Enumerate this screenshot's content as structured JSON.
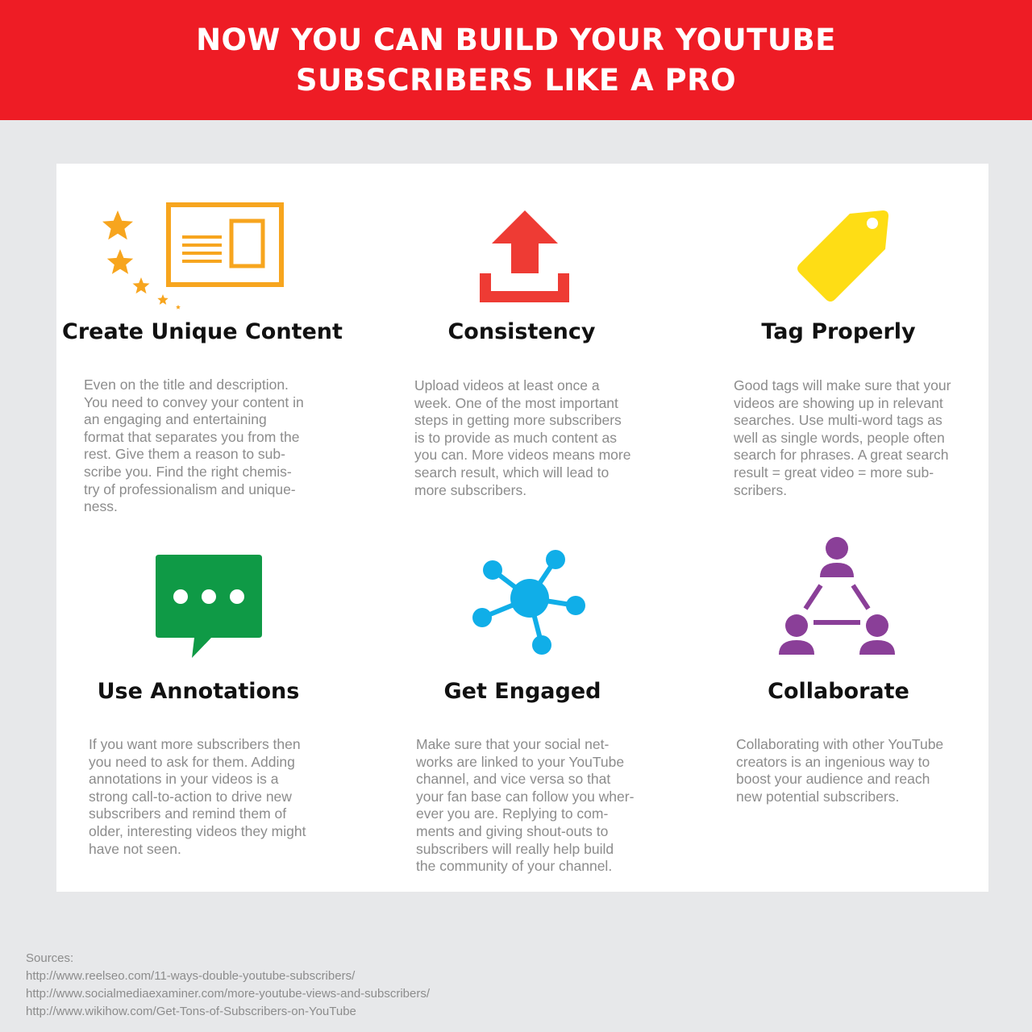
{
  "header": {
    "line1": "NOW YOU CAN BUILD YOUR YOUTUBE",
    "line2": "SUBSCRIBERS LIKE A PRO"
  },
  "colors": {
    "header_red": "#ee1c25",
    "content_orange": "#f7a51e",
    "upload_red": "#ee3b34",
    "tag_yellow": "#fedd15",
    "annotation_green": "#0f9a46",
    "engaged_blue": "#10aee8",
    "collab_purple": "#8a3f98"
  },
  "tips": [
    {
      "icon": "content-card-stars-icon",
      "title": "Create Unique Content",
      "text": "Even on the title and description.\nYou need to convey your content in\nan engaging and entertaining\nformat that separates you from the\nrest. Give them a reason to sub-\nscribe you. Find the right chemis-\ntry of professionalism and unique-\nness."
    },
    {
      "icon": "upload-icon",
      "title": "Consistency",
      "text": "Upload videos at least once a\nweek. One of the most important\nsteps in getting more subscribers\nis to provide as much content as\nyou can. More videos means more\nsearch result, which will lead to\nmore subscribers."
    },
    {
      "icon": "tag-icon",
      "title": "Tag Properly",
      "text": "Good tags will make sure that your\nvideos are showing up in relevant\nsearches. Use multi-word tags as\nwell as single words, people often\nsearch for phrases. A great search\nresult = great video = more sub-\nscribers."
    },
    {
      "icon": "speech-bubble-icon",
      "title": "Use Annotations",
      "text": "If you want more subscribers then\nyou need to ask for them. Adding\nannotations in your videos is a\nstrong call-to-action to drive new\nsubscribers and remind them of\nolder, interesting videos they might\nhave not seen."
    },
    {
      "icon": "network-icon",
      "title": "Get Engaged",
      "text": "Make sure that your social net-\nworks are linked to your YouTube\nchannel, and vice versa so that\nyour fan base can follow you wher-\never you are. Replying to com-\nments and giving shout-outs to\nsubscribers will really help build\nthe community of your channel."
    },
    {
      "icon": "people-triangle-icon",
      "title": "Collaborate",
      "text": "Collaborating with other YouTube\ncreators is an ingenious way to\nboost your audience and reach\nnew potential subscribers."
    }
  ],
  "sources": {
    "label": "Sources:",
    "links": [
      "http://www.reelseo.com/11-ways-double-youtube-subscribers/",
      "http://www.socialmediaexaminer.com/more-youtube-views-and-subscribers/",
      "http://www.wikihow.com/Get-Tons-of-Subscribers-on-YouTube"
    ]
  }
}
